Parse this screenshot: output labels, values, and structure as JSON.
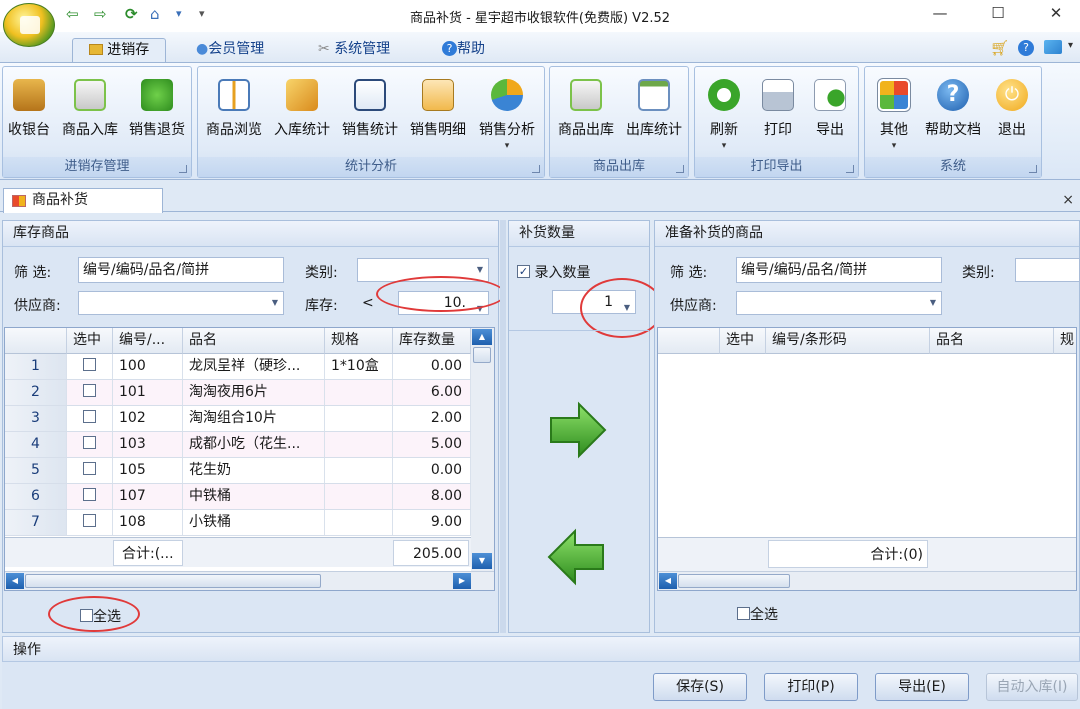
{
  "window": {
    "title": "商品补货 - 星宇超市收银软件(免费版) V2.52",
    "min": "—",
    "max": "☐",
    "close": "✕"
  },
  "qat": {
    "back": "⇦",
    "forward": "⇨",
    "refresh": "⟳",
    "home": "⌂",
    "dropdown": "▾"
  },
  "menu_tabs": [
    {
      "label": "进销存",
      "icon": "folder-icon"
    },
    {
      "label": "会员管理",
      "icon": "members-icon"
    },
    {
      "label": "系统管理",
      "icon": "tools-icon"
    },
    {
      "label": "帮助",
      "icon": "help-icon"
    }
  ],
  "ribbon": {
    "groups": [
      {
        "title": "进销存管理",
        "buttons": [
          "收银台",
          "商品入库",
          "销售退货"
        ]
      },
      {
        "title": "统计分析",
        "buttons": [
          "商品浏览",
          "入库统计",
          "销售统计",
          "销售明细",
          "销售分析"
        ]
      },
      {
        "title": "商品出库",
        "buttons": [
          "商品出库",
          "出库统计"
        ]
      },
      {
        "title": "打印导出",
        "buttons": [
          "刷新",
          "打印",
          "导出"
        ]
      },
      {
        "title": "系统",
        "buttons": [
          "其他",
          "帮助文档",
          "退出"
        ]
      }
    ],
    "dropdown_mark": "▾"
  },
  "doc_tab": {
    "label": "商品补货",
    "close": "×"
  },
  "left_panel": {
    "header": "库存商品",
    "filter_label": "筛  选:",
    "filter_value": "编号/编码/品名/简拼",
    "category_label": "类别:",
    "supplier_label": "供应商:",
    "stock_label": "库存:",
    "stock_op": "<",
    "stock_value": "10.",
    "columns": [
      "选中",
      "编号/...",
      "品名",
      "规格",
      "库存数量"
    ],
    "rows": [
      {
        "n": "1",
        "code": "100",
        "name": "龙凤呈祥（硬珍...",
        "spec": "1*10盒",
        "qty": "0.00"
      },
      {
        "n": "2",
        "code": "101",
        "name": "淘淘夜用6片",
        "spec": "",
        "qty": "6.00"
      },
      {
        "n": "3",
        "code": "102",
        "name": "淘淘组合10片",
        "spec": "",
        "qty": "2.00"
      },
      {
        "n": "4",
        "code": "103",
        "name": "成都小吃（花生...",
        "spec": "",
        "qty": "5.00"
      },
      {
        "n": "5",
        "code": "105",
        "name": "花生奶",
        "spec": "",
        "qty": "0.00"
      },
      {
        "n": "6",
        "code": "107",
        "name": "中铁桶",
        "spec": "",
        "qty": "8.00"
      },
      {
        "n": "7",
        "code": "108",
        "name": "小铁桶",
        "spec": "",
        "qty": "9.00"
      }
    ],
    "footer_count": "合计:(...",
    "footer_total": "205.00",
    "select_all": "全选"
  },
  "middle_panel": {
    "header": "补货数量",
    "enter_qty_label": "录入数量",
    "qty_value": "1"
  },
  "right_panel": {
    "header": "准备补货的商品",
    "filter_label": "筛  选:",
    "filter_value": "编号/编码/品名/简拼",
    "category_label": "类别:",
    "supplier_label": "供应商:",
    "columns": [
      "选中",
      "编号/条形码",
      "品名",
      "规"
    ],
    "footer_count": "合计:(0)",
    "select_all": "全选"
  },
  "operations": {
    "header": "操作",
    "save": "保存(S)",
    "print": "打印(P)",
    "export": "导出(E)",
    "auto_stock": "自动入库(I)"
  },
  "colors": {
    "accent": "#15428b",
    "highlight_circle": "#e03a3a",
    "arrow_green": "#3aa52a"
  }
}
